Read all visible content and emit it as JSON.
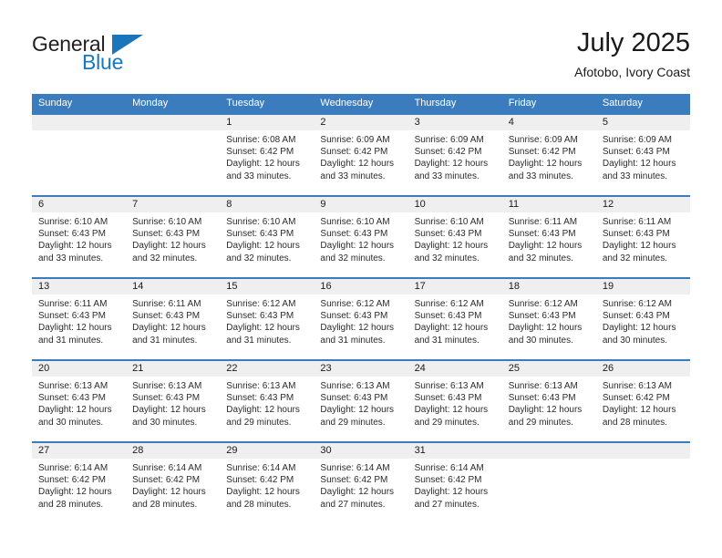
{
  "brand": {
    "name_top": "General",
    "name_bottom": "Blue"
  },
  "header": {
    "title": "July 2025",
    "subtitle": "Afotobo, Ivory Coast"
  },
  "colors": {
    "header_blue": "#3b7cbf",
    "brand_blue": "#1b75bb",
    "daynum_band": "#efefef",
    "text": "#2b2b2b"
  },
  "weekdays": [
    "Sunday",
    "Monday",
    "Tuesday",
    "Wednesday",
    "Thursday",
    "Friday",
    "Saturday"
  ],
  "weeks": [
    {
      "days": [
        {
          "num": "",
          "sunrise": "",
          "sunset": "",
          "daylight1": "",
          "daylight2": ""
        },
        {
          "num": "",
          "sunrise": "",
          "sunset": "",
          "daylight1": "",
          "daylight2": ""
        },
        {
          "num": "1",
          "sunrise": "Sunrise: 6:08 AM",
          "sunset": "Sunset: 6:42 PM",
          "daylight1": "Daylight: 12 hours",
          "daylight2": "and 33 minutes."
        },
        {
          "num": "2",
          "sunrise": "Sunrise: 6:09 AM",
          "sunset": "Sunset: 6:42 PM",
          "daylight1": "Daylight: 12 hours",
          "daylight2": "and 33 minutes."
        },
        {
          "num": "3",
          "sunrise": "Sunrise: 6:09 AM",
          "sunset": "Sunset: 6:42 PM",
          "daylight1": "Daylight: 12 hours",
          "daylight2": "and 33 minutes."
        },
        {
          "num": "4",
          "sunrise": "Sunrise: 6:09 AM",
          "sunset": "Sunset: 6:42 PM",
          "daylight1": "Daylight: 12 hours",
          "daylight2": "and 33 minutes."
        },
        {
          "num": "5",
          "sunrise": "Sunrise: 6:09 AM",
          "sunset": "Sunset: 6:43 PM",
          "daylight1": "Daylight: 12 hours",
          "daylight2": "and 33 minutes."
        }
      ]
    },
    {
      "days": [
        {
          "num": "6",
          "sunrise": "Sunrise: 6:10 AM",
          "sunset": "Sunset: 6:43 PM",
          "daylight1": "Daylight: 12 hours",
          "daylight2": "and 33 minutes."
        },
        {
          "num": "7",
          "sunrise": "Sunrise: 6:10 AM",
          "sunset": "Sunset: 6:43 PM",
          "daylight1": "Daylight: 12 hours",
          "daylight2": "and 32 minutes."
        },
        {
          "num": "8",
          "sunrise": "Sunrise: 6:10 AM",
          "sunset": "Sunset: 6:43 PM",
          "daylight1": "Daylight: 12 hours",
          "daylight2": "and 32 minutes."
        },
        {
          "num": "9",
          "sunrise": "Sunrise: 6:10 AM",
          "sunset": "Sunset: 6:43 PM",
          "daylight1": "Daylight: 12 hours",
          "daylight2": "and 32 minutes."
        },
        {
          "num": "10",
          "sunrise": "Sunrise: 6:10 AM",
          "sunset": "Sunset: 6:43 PM",
          "daylight1": "Daylight: 12 hours",
          "daylight2": "and 32 minutes."
        },
        {
          "num": "11",
          "sunrise": "Sunrise: 6:11 AM",
          "sunset": "Sunset: 6:43 PM",
          "daylight1": "Daylight: 12 hours",
          "daylight2": "and 32 minutes."
        },
        {
          "num": "12",
          "sunrise": "Sunrise: 6:11 AM",
          "sunset": "Sunset: 6:43 PM",
          "daylight1": "Daylight: 12 hours",
          "daylight2": "and 32 minutes."
        }
      ]
    },
    {
      "days": [
        {
          "num": "13",
          "sunrise": "Sunrise: 6:11 AM",
          "sunset": "Sunset: 6:43 PM",
          "daylight1": "Daylight: 12 hours",
          "daylight2": "and 31 minutes."
        },
        {
          "num": "14",
          "sunrise": "Sunrise: 6:11 AM",
          "sunset": "Sunset: 6:43 PM",
          "daylight1": "Daylight: 12 hours",
          "daylight2": "and 31 minutes."
        },
        {
          "num": "15",
          "sunrise": "Sunrise: 6:12 AM",
          "sunset": "Sunset: 6:43 PM",
          "daylight1": "Daylight: 12 hours",
          "daylight2": "and 31 minutes."
        },
        {
          "num": "16",
          "sunrise": "Sunrise: 6:12 AM",
          "sunset": "Sunset: 6:43 PM",
          "daylight1": "Daylight: 12 hours",
          "daylight2": "and 31 minutes."
        },
        {
          "num": "17",
          "sunrise": "Sunrise: 6:12 AM",
          "sunset": "Sunset: 6:43 PM",
          "daylight1": "Daylight: 12 hours",
          "daylight2": "and 31 minutes."
        },
        {
          "num": "18",
          "sunrise": "Sunrise: 6:12 AM",
          "sunset": "Sunset: 6:43 PM",
          "daylight1": "Daylight: 12 hours",
          "daylight2": "and 30 minutes."
        },
        {
          "num": "19",
          "sunrise": "Sunrise: 6:12 AM",
          "sunset": "Sunset: 6:43 PM",
          "daylight1": "Daylight: 12 hours",
          "daylight2": "and 30 minutes."
        }
      ]
    },
    {
      "days": [
        {
          "num": "20",
          "sunrise": "Sunrise: 6:13 AM",
          "sunset": "Sunset: 6:43 PM",
          "daylight1": "Daylight: 12 hours",
          "daylight2": "and 30 minutes."
        },
        {
          "num": "21",
          "sunrise": "Sunrise: 6:13 AM",
          "sunset": "Sunset: 6:43 PM",
          "daylight1": "Daylight: 12 hours",
          "daylight2": "and 30 minutes."
        },
        {
          "num": "22",
          "sunrise": "Sunrise: 6:13 AM",
          "sunset": "Sunset: 6:43 PM",
          "daylight1": "Daylight: 12 hours",
          "daylight2": "and 29 minutes."
        },
        {
          "num": "23",
          "sunrise": "Sunrise: 6:13 AM",
          "sunset": "Sunset: 6:43 PM",
          "daylight1": "Daylight: 12 hours",
          "daylight2": "and 29 minutes."
        },
        {
          "num": "24",
          "sunrise": "Sunrise: 6:13 AM",
          "sunset": "Sunset: 6:43 PM",
          "daylight1": "Daylight: 12 hours",
          "daylight2": "and 29 minutes."
        },
        {
          "num": "25",
          "sunrise": "Sunrise: 6:13 AM",
          "sunset": "Sunset: 6:43 PM",
          "daylight1": "Daylight: 12 hours",
          "daylight2": "and 29 minutes."
        },
        {
          "num": "26",
          "sunrise": "Sunrise: 6:13 AM",
          "sunset": "Sunset: 6:42 PM",
          "daylight1": "Daylight: 12 hours",
          "daylight2": "and 28 minutes."
        }
      ]
    },
    {
      "days": [
        {
          "num": "27",
          "sunrise": "Sunrise: 6:14 AM",
          "sunset": "Sunset: 6:42 PM",
          "daylight1": "Daylight: 12 hours",
          "daylight2": "and 28 minutes."
        },
        {
          "num": "28",
          "sunrise": "Sunrise: 6:14 AM",
          "sunset": "Sunset: 6:42 PM",
          "daylight1": "Daylight: 12 hours",
          "daylight2": "and 28 minutes."
        },
        {
          "num": "29",
          "sunrise": "Sunrise: 6:14 AM",
          "sunset": "Sunset: 6:42 PM",
          "daylight1": "Daylight: 12 hours",
          "daylight2": "and 28 minutes."
        },
        {
          "num": "30",
          "sunrise": "Sunrise: 6:14 AM",
          "sunset": "Sunset: 6:42 PM",
          "daylight1": "Daylight: 12 hours",
          "daylight2": "and 27 minutes."
        },
        {
          "num": "31",
          "sunrise": "Sunrise: 6:14 AM",
          "sunset": "Sunset: 6:42 PM",
          "daylight1": "Daylight: 12 hours",
          "daylight2": "and 27 minutes."
        },
        {
          "num": "",
          "sunrise": "",
          "sunset": "",
          "daylight1": "",
          "daylight2": ""
        },
        {
          "num": "",
          "sunrise": "",
          "sunset": "",
          "daylight1": "",
          "daylight2": ""
        }
      ]
    }
  ]
}
